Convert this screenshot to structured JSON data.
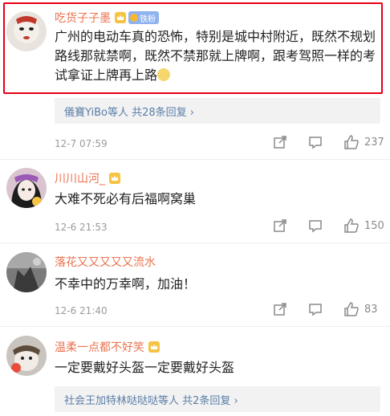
{
  "comments": [
    {
      "username": "吃货子子墨",
      "badge": "铁粉",
      "content": "广州的电动车真的恐怖，特别是城中村附近，既然不规划路线那就禁啊，既然不禁那就上牌啊，跟考驾照一样的考试拿证上牌再上路",
      "replies_text": "儀寶YiBo等人 共28条回复 ›",
      "time": "12-7 07:59",
      "likes": "237"
    },
    {
      "username": "川川山河_",
      "content": "大难不死必有后福啊窝巢",
      "time": "12-6 21:53",
      "likes": "150"
    },
    {
      "username": "落花又又又又又流水",
      "content": "不幸中的万幸啊，加油！",
      "time": "12-6 21:40",
      "likes": "83"
    },
    {
      "username": "温柔一点都不好笑",
      "content": "一定要戴好头盔一定要戴好头盔",
      "replies_text": "社会王加特林哒哒哒等人 共2条回复 ›",
      "time": "",
      "likes": ""
    }
  ],
  "colors": {
    "username": "#eb7350",
    "reply_link": "#5a7ea8",
    "highlight_border": "#e60012"
  },
  "icons": [
    "share-icon",
    "comment-icon",
    "like-icon",
    "crown-icon",
    "emoji-icon"
  ]
}
